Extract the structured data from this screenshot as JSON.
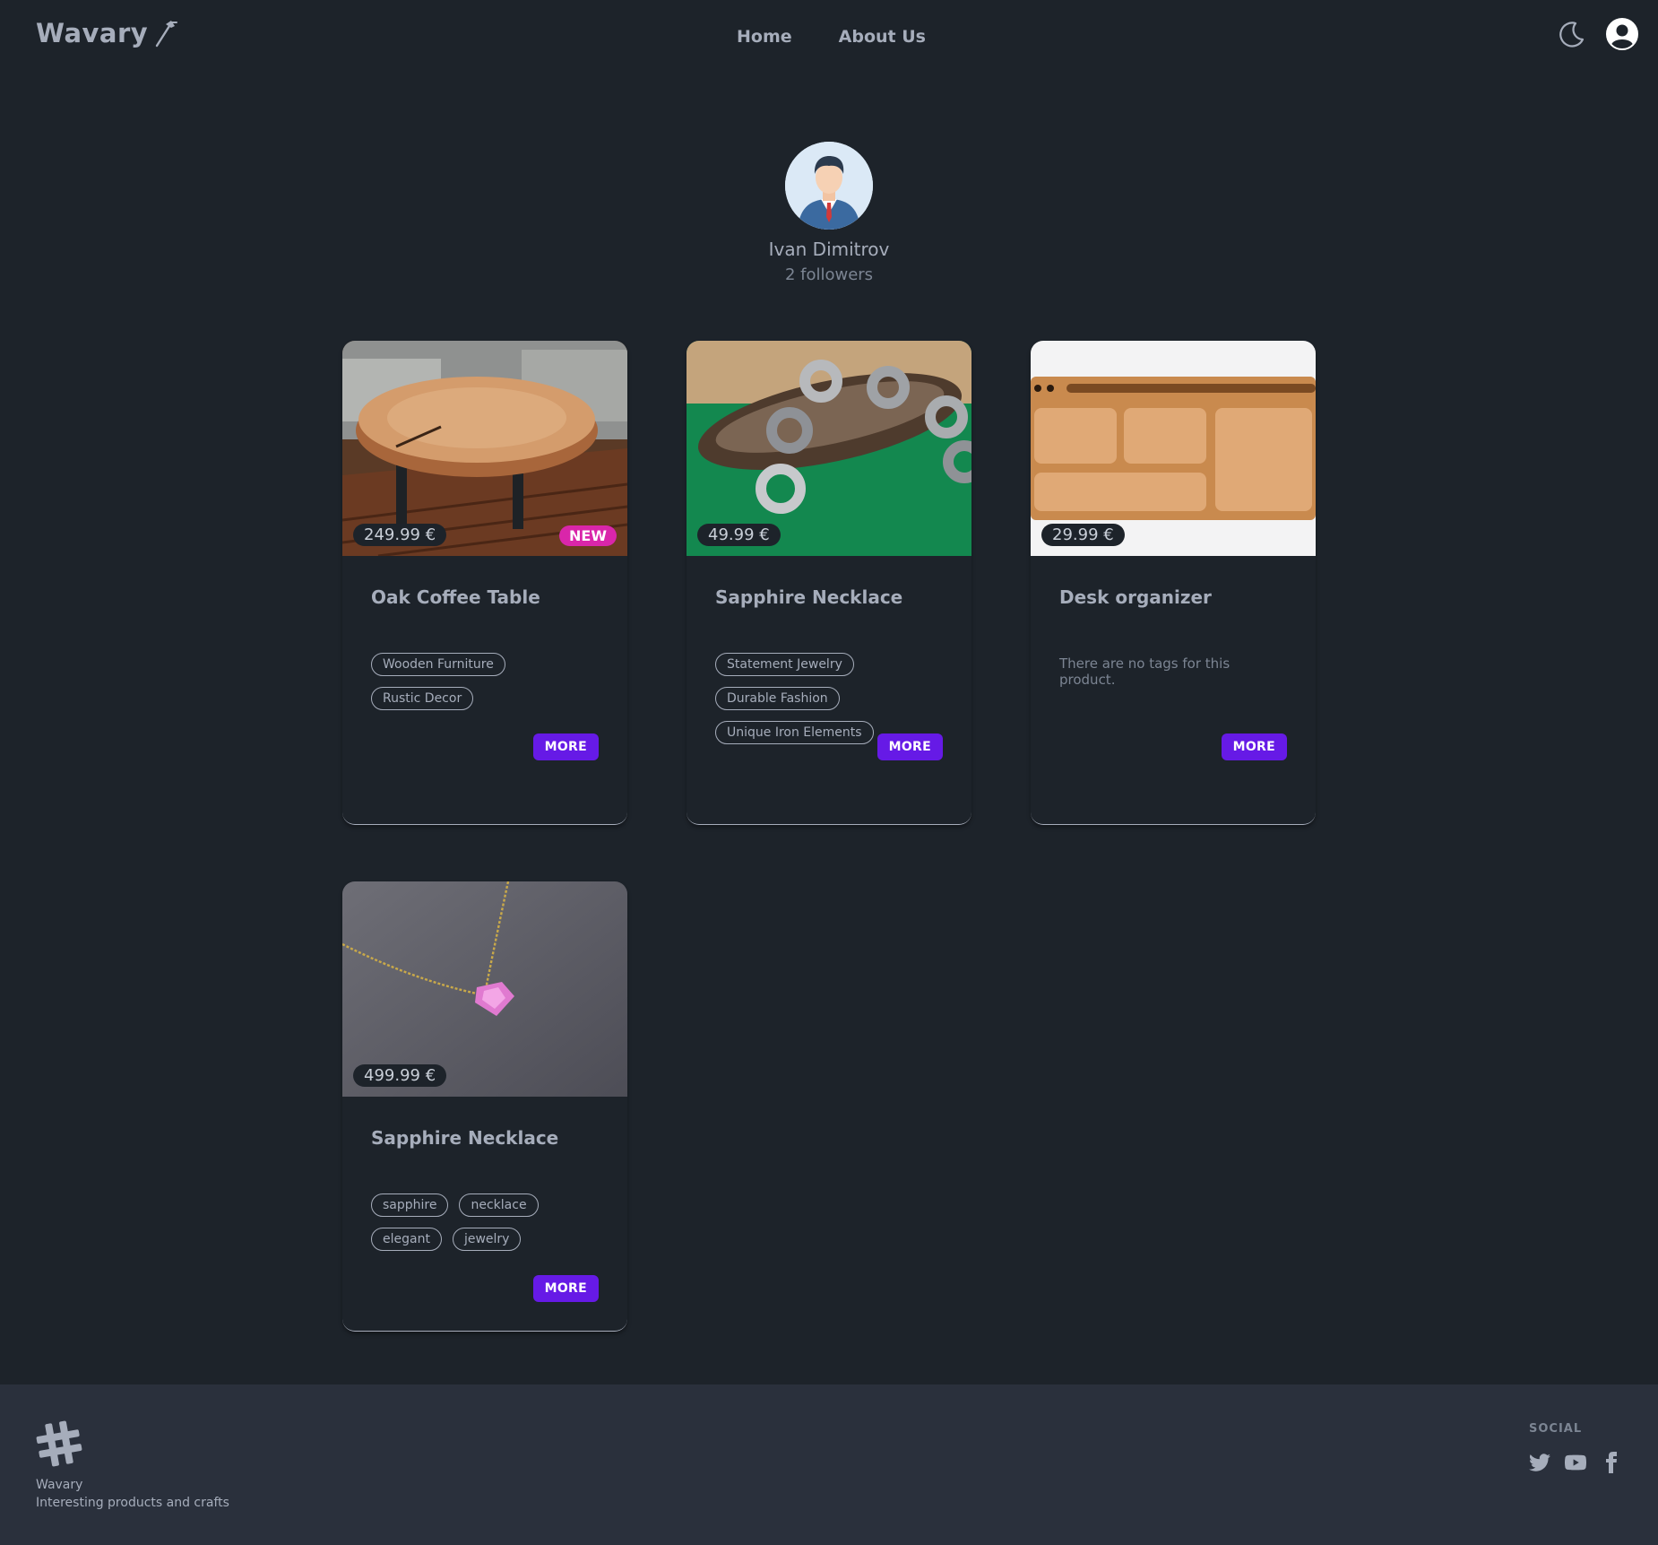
{
  "nav": {
    "brand": "Wavary",
    "links": [
      "Home",
      "About Us"
    ],
    "icons": [
      "hammer-icon",
      "moon-icon",
      "user-avatar-icon"
    ]
  },
  "profile": {
    "name": "Ivan Dimitrov",
    "followers": "2 followers"
  },
  "products": [
    {
      "title": "Oak Coffee Table",
      "price": "249.99 €",
      "badge": "NEW",
      "tags": [
        "Wooden Furniture",
        "Rustic Decor"
      ],
      "no_tags_text": "",
      "more_label": "MORE"
    },
    {
      "title": "Sapphire Necklace",
      "price": "49.99 €",
      "badge": "",
      "tags": [
        "Statement Jewelry",
        "Durable Fashion",
        "Unique Iron Elements"
      ],
      "no_tags_text": "",
      "more_label": "MORE"
    },
    {
      "title": "Desk organizer",
      "price": "29.99 €",
      "badge": "",
      "tags": [],
      "no_tags_text": "There are no tags for this product.",
      "more_label": "MORE"
    },
    {
      "title": "Sapphire Necklace",
      "price": "499.99 €",
      "badge": "",
      "tags": [
        "sapphire",
        "necklace",
        "elegant",
        "jewelry"
      ],
      "no_tags_text": "",
      "more_label": "MORE"
    }
  ],
  "footer": {
    "brand": "Wavary",
    "tagline": "Interesting products and crafts",
    "social_title": "SOCIAL",
    "social_icons": [
      "twitter-icon",
      "youtube-icon",
      "facebook-icon"
    ]
  },
  "colors": {
    "background": "#1d232a",
    "footer": "#2a303c",
    "text": "#a6adbb",
    "primary_button": "#661ae6",
    "new_badge": "#d926aa"
  }
}
